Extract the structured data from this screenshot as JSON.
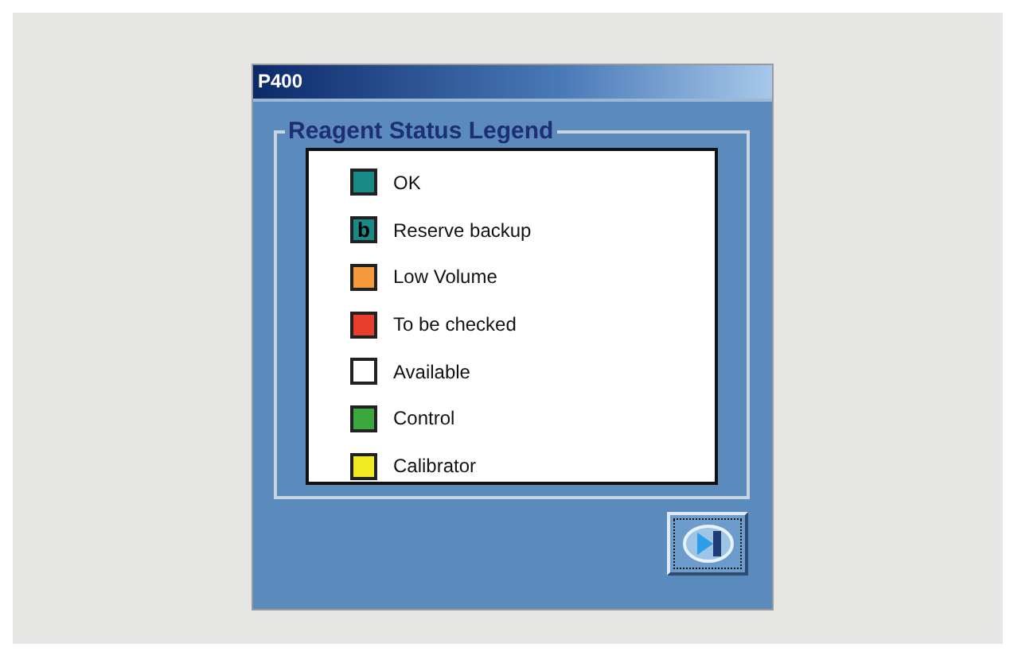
{
  "window": {
    "title": "P400"
  },
  "legend": {
    "title": "Reagent Status Legend",
    "items": [
      {
        "label": "OK",
        "color": "#1a8a86"
      },
      {
        "label": "Reserve backup",
        "color": "#1a8a86",
        "glyph": "b"
      },
      {
        "label": "Low Volume",
        "color": "#f49a3c"
      },
      {
        "label": "To be checked",
        "color": "#ea3e2c"
      },
      {
        "label": "Available",
        "color": "#ffffff"
      },
      {
        "label": "Control",
        "color": "#3aa83e"
      },
      {
        "label": "Calibrator",
        "color": "#f0ea22"
      }
    ]
  }
}
